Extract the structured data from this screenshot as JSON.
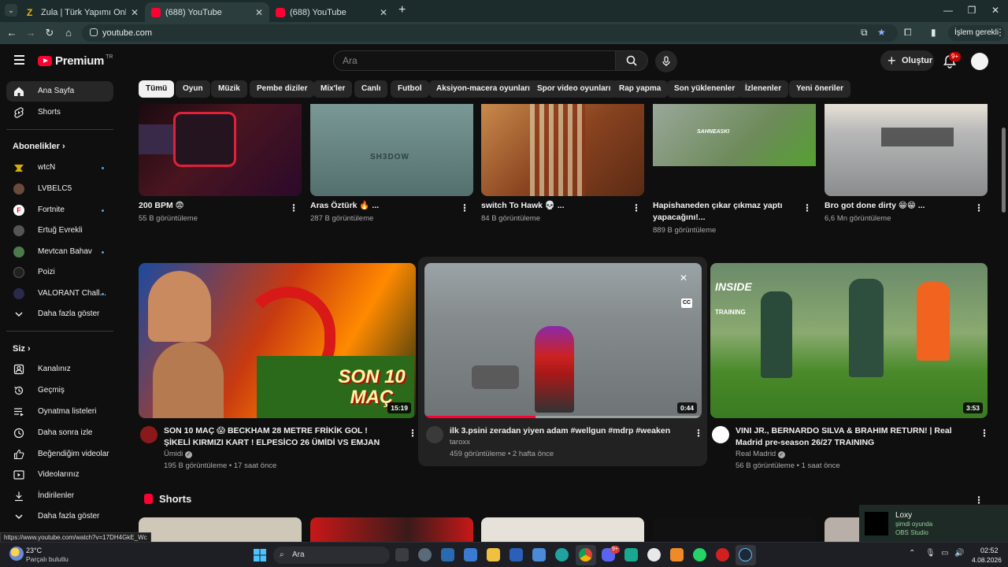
{
  "browser": {
    "tabs": [
      {
        "title": "Zula | Türk Yapımı Online Silah",
        "active": false,
        "favicon_color": "#f5b400"
      },
      {
        "title": "(688) YouTube",
        "active": true,
        "favicon_color": "#ff0033"
      },
      {
        "title": "(688) YouTube",
        "active": false,
        "favicon_color": "#ff0033"
      }
    ],
    "new_tab": "+",
    "address": "youtube.com",
    "profile_button": "İşlem gerekli"
  },
  "header": {
    "logo_word": "Premium",
    "logo_country": "TR",
    "search_placeholder": "Ara",
    "create_label": "Oluştur",
    "notification_badge": "9+"
  },
  "chips": [
    "Tümü",
    "Oyun",
    "Müzik",
    "Pembe diziler",
    "Mix'ler",
    "Canlı",
    "Futbol",
    "Aksiyon-macera oyunları",
    "Spor video oyunları",
    "Rap yapma",
    "Son yüklenenler",
    "İzlenenler",
    "Yeni öneriler"
  ],
  "sidebar": {
    "main": [
      {
        "label": "Ana Sayfa",
        "icon": "home-icon"
      },
      {
        "label": "Shorts",
        "icon": "shorts-icon"
      }
    ],
    "subs_heading": "Abonelikler",
    "subscriptions": [
      {
        "label": "wtcN",
        "color": "#d4b000",
        "new": true
      },
      {
        "label": "LVBELC5",
        "color": "#6a4a3a",
        "new": false
      },
      {
        "label": "Fortnite",
        "color": "#ffffff",
        "new": true
      },
      {
        "label": "Ertuğ Evrekli",
        "color": "#555555",
        "new": false
      },
      {
        "label": "Mevtcan Bahav",
        "color": "#4d7a4d",
        "new": true
      },
      {
        "label": "Poizi",
        "color": "#222222",
        "new": false
      },
      {
        "label": "VALORANT Chall...",
        "color": "#2a2a4a",
        "new": true
      }
    ],
    "subs_more": "Daha fazla göster",
    "you_heading": "Siz",
    "you_items": [
      {
        "label": "Kanalınız",
        "icon": "channel-icon"
      },
      {
        "label": "Geçmiş",
        "icon": "history-icon"
      },
      {
        "label": "Oynatma listeleri",
        "icon": "playlist-icon"
      },
      {
        "label": "Daha sonra izle",
        "icon": "clock-icon"
      },
      {
        "label": "Beğendiğim videolar",
        "icon": "like-icon"
      },
      {
        "label": "Videolarınız",
        "icon": "video-icon"
      },
      {
        "label": "İndirilenler",
        "icon": "download-icon"
      },
      {
        "label": "Daha fazla göster",
        "icon": "chevron-down-icon"
      }
    ]
  },
  "row1": [
    {
      "title": "200 BPM 😨",
      "meta": "55 B görüntüleme",
      "thumb_color": "#2b1418"
    },
    {
      "title": "Aras Öztürk 🔥 ...",
      "meta": "287 B görüntüleme",
      "thumb_color": "#5f7d7c",
      "overlay": "SH3DOW"
    },
    {
      "title": "switch To Hawk 💀 ...",
      "meta": "84 B görüntüleme",
      "thumb_color": "#9a5a2c"
    },
    {
      "title": "Hapishaneden çıkar çıkmaz yaptı yapacağını!...",
      "meta": "889 B görüntüleme",
      "thumb_color": "#6d7d6a",
      "overlay": "SAHNEASKI"
    },
    {
      "title": "Bro got done dirty 😁😁 ...",
      "meta": "6,6 Mn görüntüleme",
      "thumb_color": "#c9c4bb"
    }
  ],
  "row2": [
    {
      "title": "SON 10 MAÇ 😱 BECKHAM 28 METRE FRİKİK GOL ! ŞİKELİ KIRMIZI KART ! ELPESİCO 26 ÜMİDİ VS EMJAN",
      "channel": "Ümidi",
      "verified": true,
      "meta": "195 B görüntüleme • 17 saat önce",
      "duration": "15:19",
      "overlay": "SON 10 MAÇ"
    },
    {
      "title": "ilk 3.psini zeradan yiyen adam #wellgun #mdrp  #weaken",
      "channel": "taroxx",
      "verified": false,
      "meta": "459 görüntüleme • 2 hafta önce",
      "duration": "0:44",
      "progress": 0.4,
      "cc": "CC"
    },
    {
      "title": "VINI JR., BERNARDO SILVA & BRAHIM RETURN! | Real Madrid pre-season 26/27 TRAINING",
      "channel": "Real Madrid",
      "verified": true,
      "meta": "56 B görüntüleme • 1 saat önce",
      "duration": "3:53",
      "overlay_top": "INSIDE",
      "overlay_bottom": "TRAINING"
    }
  ],
  "shorts_heading": "Shorts",
  "status_url": "https://www.youtube.com/watch?v=17DH4GkE_Wc",
  "notification": {
    "title": "Loxy",
    "line1": "şimdi oyunda",
    "line2": "OBS Studio"
  },
  "taskbar": {
    "weather_temp": "23°C",
    "weather_desc": "Parçalı bulutlu",
    "search": "Ara",
    "time": "02:52",
    "date": "4.08.2026",
    "discord_badge": "9+"
  }
}
